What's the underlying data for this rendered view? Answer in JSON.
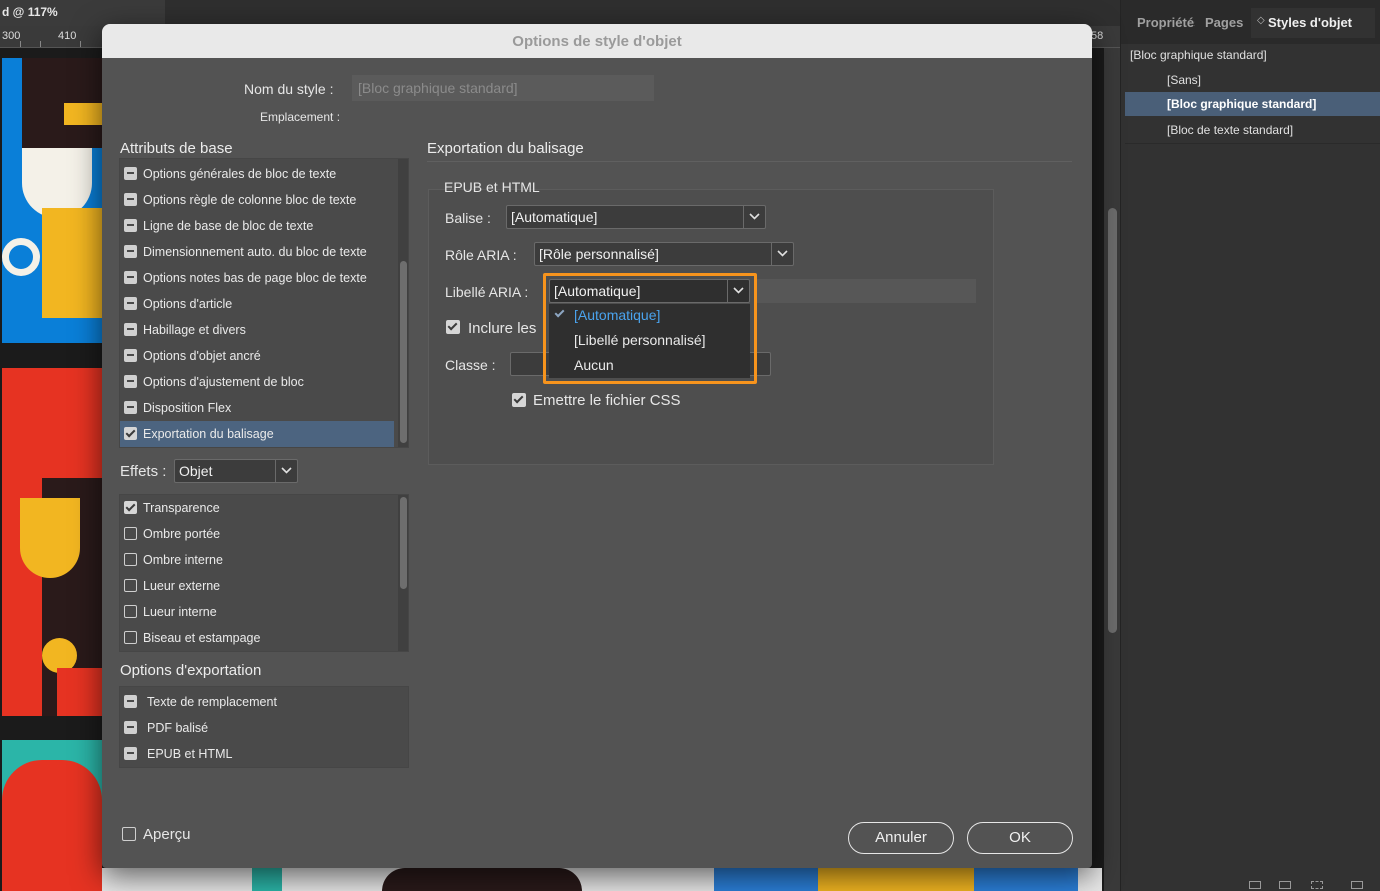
{
  "document": {
    "title": "d @ 117%",
    "ruler_labels": [
      "300",
      "410",
      "58"
    ]
  },
  "right_panel": {
    "tabs": [
      "Propriétés",
      "Pages",
      "Styles d'objet"
    ],
    "active_tab": "Styles d'objet",
    "current_style": "[Bloc graphique standard]",
    "styles": [
      "[Sans]",
      "[Bloc graphique standard]",
      "[Bloc de texte standard]"
    ],
    "selected_style": "[Bloc graphique standard]"
  },
  "dialog": {
    "title": "Options de style d'objet",
    "style_name_label": "Nom du style :",
    "style_name_value": "[Bloc graphique standard]",
    "location_label": "Emplacement :",
    "base_attributes": {
      "title": "Attributs de base",
      "items": [
        {
          "label": "Options générales de bloc de texte",
          "state": "mixed"
        },
        {
          "label": "Options règle de colonne bloc de texte",
          "state": "mixed"
        },
        {
          "label": "Ligne de base de bloc de texte",
          "state": "mixed"
        },
        {
          "label": "Dimensionnement auto. du bloc de texte",
          "state": "mixed"
        },
        {
          "label": "Options notes bas de page bloc de texte",
          "state": "mixed"
        },
        {
          "label": "Options d'article",
          "state": "mixed"
        },
        {
          "label": "Habillage et divers",
          "state": "mixed"
        },
        {
          "label": "Options d'objet ancré",
          "state": "mixed"
        },
        {
          "label": "Options d'ajustement de bloc",
          "state": "mixed"
        },
        {
          "label": "Disposition Flex",
          "state": "mixed"
        },
        {
          "label": "Exportation du balisage",
          "state": "checked",
          "selected": true
        }
      ]
    },
    "effects": {
      "label": "Effets :",
      "select_value": "Objet",
      "items": [
        {
          "label": "Transparence",
          "state": "checked"
        },
        {
          "label": "Ombre portée",
          "state": "empty"
        },
        {
          "label": "Ombre interne",
          "state": "empty"
        },
        {
          "label": "Lueur externe",
          "state": "empty"
        },
        {
          "label": "Lueur interne",
          "state": "empty"
        },
        {
          "label": "Biseau et estampage",
          "state": "empty"
        }
      ]
    },
    "export_options": {
      "title": "Options d'exportation",
      "items": [
        {
          "label": "Texte de remplacement",
          "state": "mixed"
        },
        {
          "label": "PDF balisé",
          "state": "mixed"
        },
        {
          "label": "EPUB et HTML",
          "state": "mixed"
        }
      ]
    },
    "preview_label": "Aperçu",
    "main": {
      "section_title": "Exportation du balisage",
      "group_title": "EPUB et HTML",
      "tag_label": "Balise :",
      "tag_value": "[Automatique]",
      "aria_role_label": "Rôle ARIA :",
      "aria_role_value": "[Rôle personnalisé]",
      "aria_label_label": "Libellé ARIA :",
      "aria_label_value": "[Automatique]",
      "aria_label_options": [
        "[Automatique]",
        "[Libellé personnalisé]",
        "Aucun"
      ],
      "aria_label_selected": "[Automatique]",
      "include_label": "Inclure les",
      "class_label": "Classe :",
      "emit_css_label": "Emettre le fichier CSS"
    },
    "buttons": {
      "cancel": "Annuler",
      "ok": "OK"
    }
  },
  "colors": {
    "highlight": "#f7941d",
    "selection": "#4c6480",
    "link_blue": "#4aa3ee"
  }
}
